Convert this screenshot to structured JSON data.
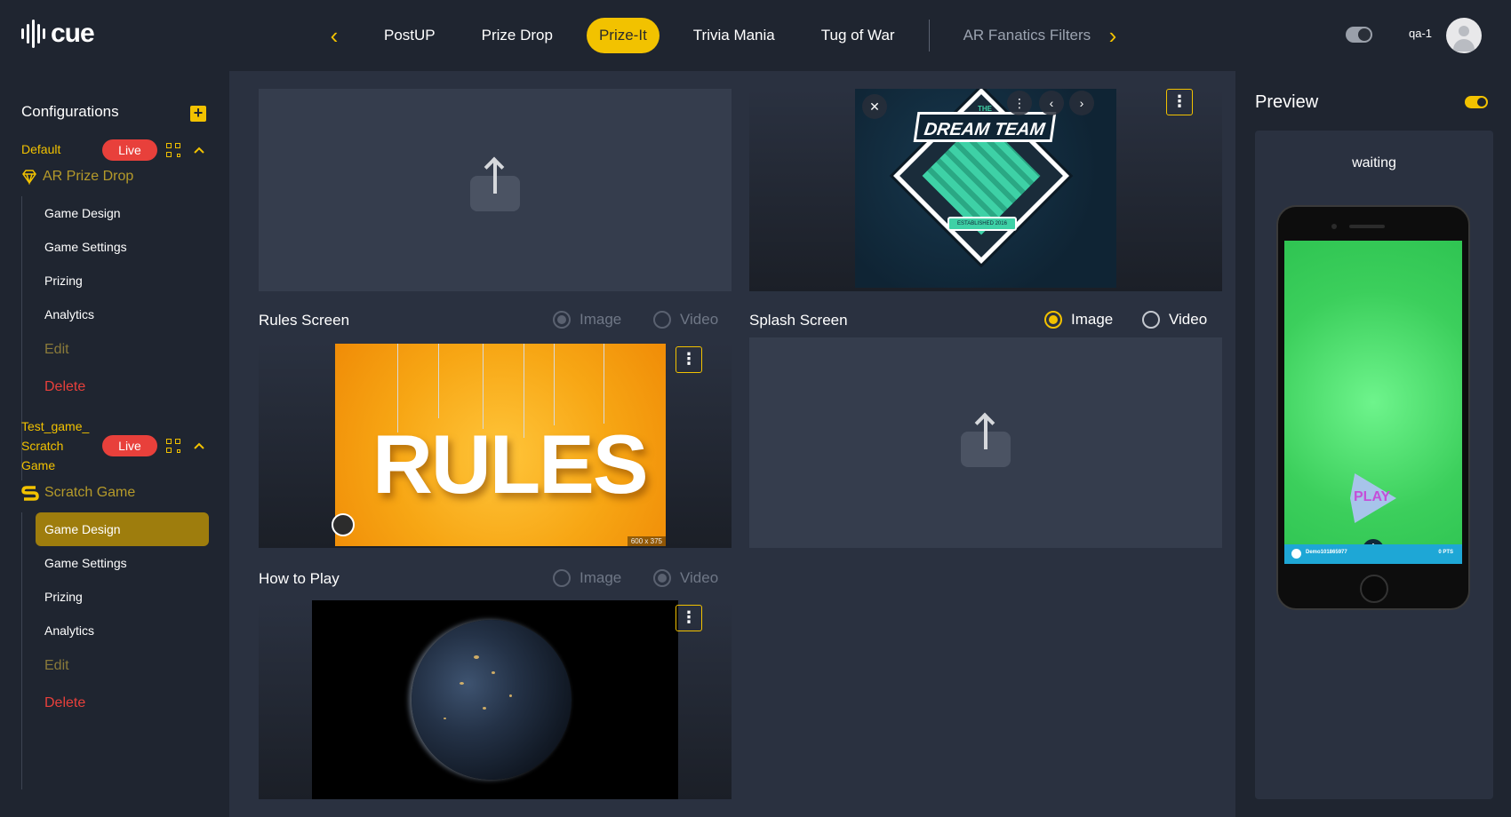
{
  "app": {
    "logo_text": "cue"
  },
  "header": {
    "tabs": [
      {
        "label": "PostUP"
      },
      {
        "label": "Prize Drop"
      },
      {
        "label": "Prize-It"
      },
      {
        "label": "Trivia Mania"
      },
      {
        "label": "Tug of War"
      },
      {
        "label": "AR Fanatics Filters"
      }
    ],
    "active_tab": "Prize-It",
    "prev_icon": "chevron-left-icon",
    "next_icon": "chevron-right-icon",
    "user_name": "qa-1"
  },
  "sidebar": {
    "title": "Configurations",
    "add_label": "+",
    "configs": [
      {
        "name": "Default",
        "status": "Live",
        "game_type": "AR Prize Drop",
        "items": [
          "Game Design",
          "Game Settings",
          "Prizing",
          "Analytics",
          "Edit",
          "Delete"
        ]
      },
      {
        "name_lines": [
          "Test_game_",
          "Scratch",
          "Game"
        ],
        "status": "Live",
        "game_type": "Scratch Game",
        "items": [
          "Game Design",
          "Game Settings",
          "Prizing",
          "Analytics",
          "Edit",
          "Delete"
        ],
        "active_item": "Game Design"
      }
    ]
  },
  "editor": {
    "rules_screen": {
      "label": "Rules Screen",
      "option_image": "Image",
      "option_video": "Video",
      "selected": "Image",
      "image_text": "RULES",
      "size_tag": "600 x 375"
    },
    "splash_screen": {
      "label": "Splash Screen",
      "option_image": "Image",
      "option_video": "Video",
      "selected": "Image"
    },
    "how_to_play": {
      "label": "How to Play",
      "option_image": "Image",
      "option_video": "Video",
      "selected": "Video"
    },
    "logo_image": {
      "top_text": "THE",
      "title_text": "DREAM TEAM",
      "ribbon_text": "ESTABLISHED 2016"
    },
    "kebab_glyph": "⋮"
  },
  "preview": {
    "title": "Preview",
    "status_text": "waiting",
    "play_label": "PLAY",
    "bar_left": "Demo101865977",
    "bar_right": "0 PTS",
    "plus_label": "+"
  },
  "colors": {
    "accent": "#f2c200",
    "live": "#e8403b",
    "bg": "#1f2530",
    "panel": "#2a3140"
  }
}
